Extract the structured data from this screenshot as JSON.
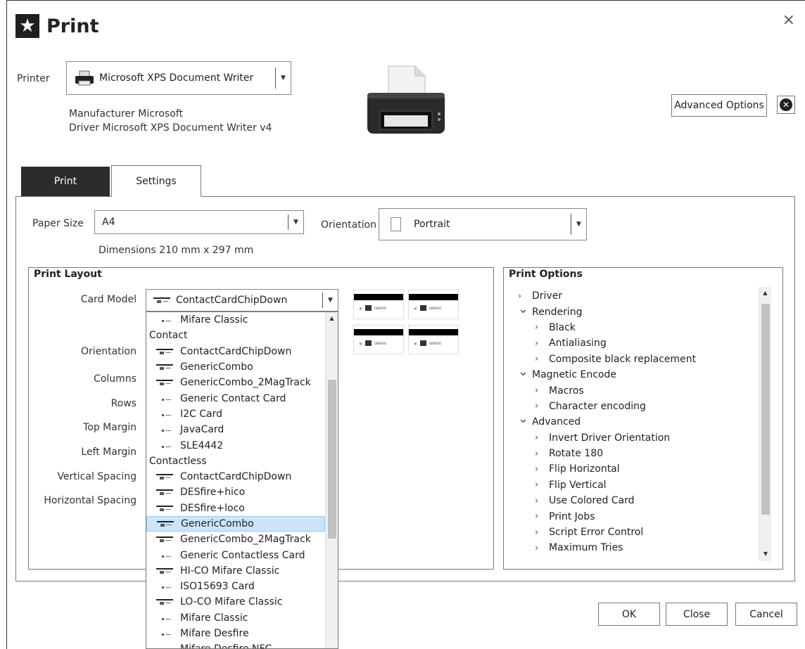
{
  "dialog": {
    "title": "Print",
    "close_label": "×"
  },
  "printer": {
    "label": "Printer",
    "selected": "Microsoft XPS Document Writer",
    "manufacturer": "Manufacturer Microsoft",
    "driver": "Driver Microsoft XPS Document Writer v4"
  },
  "advanced": {
    "button": "Advanced Options"
  },
  "tabs": [
    {
      "label": "Print"
    },
    {
      "label": "Settings"
    }
  ],
  "paper": {
    "size_label": "Paper Size",
    "size_value": "A4",
    "orientation_label": "Orientation",
    "orientation_value": "Portrait",
    "dimensions": "Dimensions 210 mm x 297 mm"
  },
  "layout": {
    "title": "Print Layout",
    "card_model_label": "Card Model",
    "card_model_value": "ContactCardChipDown",
    "fields": [
      "Orientation",
      "Columns",
      "Rows",
      "Top Margin",
      "Left Margin",
      "Vertical Spacing",
      "Horizontal Spacing"
    ],
    "preview_text": "GENERIC"
  },
  "dropdown_items": [
    {
      "type": "item",
      "icon": "small",
      "label": "Mifare Classic"
    },
    {
      "type": "group",
      "label": "Contact"
    },
    {
      "type": "item",
      "icon": "full",
      "label": "ContactCardChipDown"
    },
    {
      "type": "item",
      "icon": "full",
      "label": "GenericCombo"
    },
    {
      "type": "item",
      "icon": "full",
      "label": "GenericCombo_2MagTrack"
    },
    {
      "type": "item",
      "icon": "small",
      "label": "Generic Contact Card"
    },
    {
      "type": "item",
      "icon": "small",
      "label": "I2C Card"
    },
    {
      "type": "item",
      "icon": "small",
      "label": "JavaCard"
    },
    {
      "type": "item",
      "icon": "small",
      "label": "SLE4442"
    },
    {
      "type": "group",
      "label": "Contactless"
    },
    {
      "type": "item",
      "icon": "full",
      "label": "ContactCardChipDown"
    },
    {
      "type": "item",
      "icon": "full",
      "label": "DESfire+hico"
    },
    {
      "type": "item",
      "icon": "full",
      "label": "DESfire+loco"
    },
    {
      "type": "item",
      "icon": "full",
      "label": "GenericCombo",
      "selected": true
    },
    {
      "type": "item",
      "icon": "full",
      "label": "GenericCombo_2MagTrack"
    },
    {
      "type": "item",
      "icon": "small",
      "label": "Generic Contactless Card"
    },
    {
      "type": "item",
      "icon": "full",
      "label": "HI-CO Mifare Classic"
    },
    {
      "type": "item",
      "icon": "small",
      "label": "ISO15693 Card"
    },
    {
      "type": "item",
      "icon": "full",
      "label": "LO-CO Mifare Classic"
    },
    {
      "type": "item",
      "icon": "small",
      "label": "Mifare Classic"
    },
    {
      "type": "item",
      "icon": "small",
      "label": "Mifare Desfire"
    },
    {
      "type": "item",
      "icon": "small",
      "label": "Mifare Desfire NFC"
    }
  ],
  "options": {
    "title": "Print Options",
    "tree": [
      {
        "level": 0,
        "expanded": false,
        "label": "Driver"
      },
      {
        "level": 0,
        "expanded": true,
        "label": "Rendering"
      },
      {
        "level": 1,
        "expanded": false,
        "label": "Black"
      },
      {
        "level": 1,
        "expanded": false,
        "label": "Antialiasing"
      },
      {
        "level": 1,
        "expanded": false,
        "label": "Composite black replacement"
      },
      {
        "level": 0,
        "expanded": true,
        "label": "Magnetic Encode"
      },
      {
        "level": 1,
        "expanded": false,
        "label": "Macros"
      },
      {
        "level": 1,
        "expanded": false,
        "label": "Character encoding"
      },
      {
        "level": 0,
        "expanded": true,
        "label": "Advanced"
      },
      {
        "level": 1,
        "expanded": false,
        "label": "Invert Driver Orientation"
      },
      {
        "level": 1,
        "expanded": false,
        "label": "Rotate 180"
      },
      {
        "level": 1,
        "expanded": false,
        "label": "Flip Horizontal"
      },
      {
        "level": 1,
        "expanded": false,
        "label": "Flip Vertical"
      },
      {
        "level": 1,
        "expanded": false,
        "label": "Use Colored Card"
      },
      {
        "level": 1,
        "expanded": false,
        "label": "Print Jobs"
      },
      {
        "level": 1,
        "expanded": false,
        "label": "Script Error Control"
      },
      {
        "level": 1,
        "expanded": false,
        "label": "Maximum Tries"
      }
    ]
  },
  "footer": {
    "ok": "OK",
    "close": "Close",
    "cancel": "Cancel"
  }
}
